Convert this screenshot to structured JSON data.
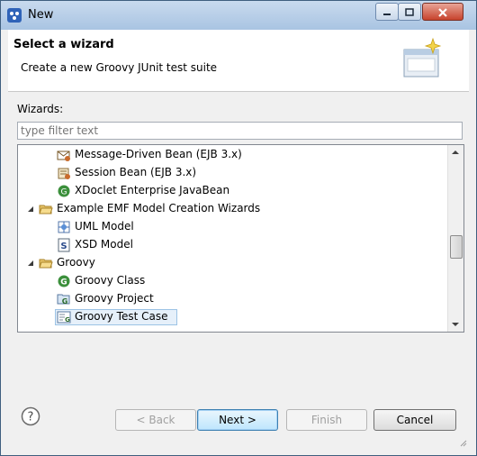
{
  "window": {
    "title": "New",
    "min_glyph": "0",
    "max_glyph": "1",
    "close_glyph": "r"
  },
  "header": {
    "title": "Select a wizard",
    "description": "Create a new Groovy JUnit test suite"
  },
  "wizards_label": "Wizards:",
  "filter": {
    "placeholder": "type filter text",
    "value": ""
  },
  "tree": {
    "items": [
      {
        "label": "Message-Driven Bean (EJB 3.x)",
        "icon": "message-bean-icon",
        "level": 2
      },
      {
        "label": "Session Bean (EJB 3.x)",
        "icon": "session-bean-icon",
        "level": 2
      },
      {
        "label": "XDoclet Enterprise JavaBean",
        "icon": "xdoclet-icon",
        "level": 2
      },
      {
        "label": "Example EMF Model Creation Wizards",
        "icon": "folder-icon",
        "level": 1,
        "expanded": true
      },
      {
        "label": "UML Model",
        "icon": "uml-model-icon",
        "level": 2
      },
      {
        "label": "XSD Model",
        "icon": "xsd-model-icon",
        "level": 2
      },
      {
        "label": "Groovy",
        "icon": "folder-icon",
        "level": 1,
        "expanded": true
      },
      {
        "label": "Groovy Class",
        "icon": "groovy-class-icon",
        "level": 2
      },
      {
        "label": "Groovy Project",
        "icon": "groovy-project-icon",
        "level": 2
      },
      {
        "label": "Groovy Test Case",
        "icon": "groovy-test-case-icon",
        "level": 2,
        "selected": true
      }
    ]
  },
  "buttons": {
    "back": "< Back",
    "next": "Next >",
    "finish": "Finish",
    "cancel": "Cancel"
  },
  "colors": {
    "accent": "#3c7fb1",
    "selection": "#e6f0fa",
    "title_bar": "#a9c4e2",
    "close": "#c7432c"
  }
}
